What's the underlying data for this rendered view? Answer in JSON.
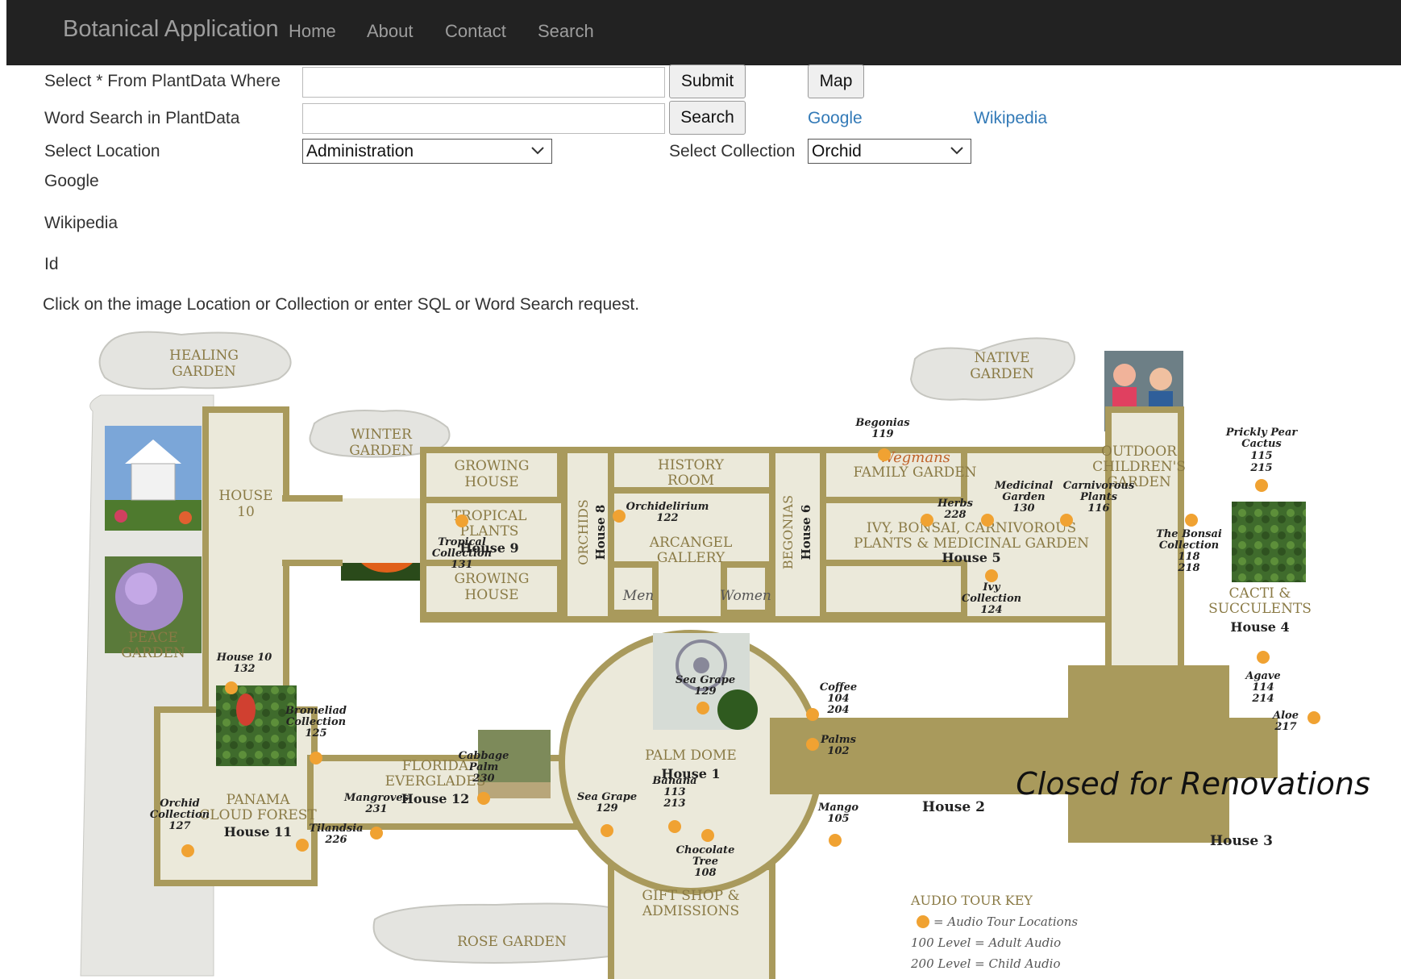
{
  "navbar": {
    "brand": "Botanical Application",
    "links": [
      "Home",
      "About",
      "Contact",
      "Search"
    ]
  },
  "form": {
    "sql_label": "Select * From PlantData Where",
    "sql_value": "",
    "submit_label": "Submit",
    "map_label": "Map",
    "word_label": "Word Search in PlantData",
    "word_value": "",
    "search_label": "Search",
    "google_link": "Google",
    "wikipedia_link": "Wikipedia",
    "location_label": "Select Location",
    "location_value": "Administration",
    "collection_label": "Select Collection",
    "collection_value": "Orchid"
  },
  "info": {
    "google": "Google",
    "wikipedia": "Wikipedia",
    "id": "Id",
    "instruction": "Click on the image Location or Collection or enter SQL or Word Search request."
  },
  "map": {
    "gardens": {
      "healing": [
        "HEALING",
        "GARDEN"
      ],
      "winter": [
        "WINTER",
        "GARDEN"
      ],
      "native": [
        "NATIVE",
        "GARDEN"
      ],
      "peace": [
        "PEACE",
        "GARDEN"
      ],
      "rose": "ROSE GARDEN",
      "outdoor": [
        "OUTDOOR",
        "CHILDREN'S",
        "GARDEN"
      ]
    },
    "rooms": {
      "house10": [
        "HOUSE",
        "10"
      ],
      "growing_top": [
        "GROWING",
        "HOUSE"
      ],
      "growing_bottom": [
        "GROWING",
        "HOUSE"
      ],
      "history": [
        "HISTORY",
        "ROOM"
      ],
      "tropical": [
        "TROPICAL",
        "PLANTS"
      ],
      "house9": "House 9",
      "orchids": "ORCHIDS",
      "house8": "House 8",
      "arcangel": [
        "ARCANGEL",
        "GALLERY"
      ],
      "begonias": "BEGONIAS",
      "house6": "House 6",
      "wegmans": "Wegmans",
      "family": "FAMILY GARDEN",
      "ivy": [
        "IVY, BONSAI, CARNIVOROUS",
        "PLANTS & MEDICINAL GARDEN"
      ],
      "house5": "House 5",
      "cacti": [
        "CACTI &",
        "SUCCULENTS"
      ],
      "house4": "House 4",
      "men": "Men",
      "women": "Women",
      "palm": "PALM DOME",
      "house1": "House 1",
      "florida": [
        "FLORIDA",
        "EVERGLADES"
      ],
      "house12": "House 12",
      "panama": [
        "PANAMA",
        "CLOUD FOREST"
      ],
      "house11": "House 11",
      "gift": [
        "GIFT SHOP &",
        "ADMISSIONS"
      ],
      "house2": "House 2",
      "house3": "House 3",
      "closed": "Closed for Renovations"
    },
    "stops": {
      "begonias": [
        "Begonias",
        "119"
      ],
      "prickly": [
        "Prickly Pear",
        "Cactus",
        "115",
        "215"
      ],
      "orchidelirium": [
        "Orchidelirium",
        "122"
      ],
      "tropical": [
        "Tropical",
        "Collection",
        "131"
      ],
      "herbs": [
        "Herbs",
        "228"
      ],
      "medicinal": [
        "Medicinal",
        "Garden",
        "130"
      ],
      "carnivorous": [
        "Carnivorous",
        "Plants",
        "116"
      ],
      "bonsai": [
        "The Bonsai",
        "Collection",
        "118",
        "218"
      ],
      "ivy": [
        "Ivy",
        "Collection",
        "124"
      ],
      "house10": [
        "House 10",
        "132"
      ],
      "bromeliad": [
        "Bromeliad",
        "Collection",
        "125"
      ],
      "seagrape_top": [
        "Sea Grape",
        "129"
      ],
      "coffee": [
        "Coffee",
        "104",
        "204"
      ],
      "palms": [
        "Palms",
        "102"
      ],
      "agave": [
        "Agave",
        "114",
        "214"
      ],
      "aloe": [
        "Aloe",
        "217"
      ],
      "cabbage": [
        "Cabbage",
        "Palm",
        "230"
      ],
      "seagrape_left": [
        "Sea Grape",
        "129"
      ],
      "orchid": [
        "Orchid",
        "Collection",
        "127"
      ],
      "mangroves": [
        "Mangroves",
        "231"
      ],
      "tilandsia": [
        "Tilandsia",
        "226"
      ],
      "banana": [
        "Banana",
        "113",
        "213"
      ],
      "chocolate": [
        "Chocolate",
        "Tree",
        "108"
      ],
      "mango": [
        "Mango",
        "105"
      ]
    },
    "key": {
      "title": "AUDIO TOUR KEY",
      "lines": [
        "= Audio Tour Locations",
        "100 Level = Adult Audio",
        "200 Level = Child Audio"
      ]
    },
    "colors": {
      "wall": "#a99a5c",
      "floor": "#ebe9da",
      "dot": "#f0a232",
      "closed": "#a99a5c",
      "cloud": "#e4e4e0"
    }
  }
}
